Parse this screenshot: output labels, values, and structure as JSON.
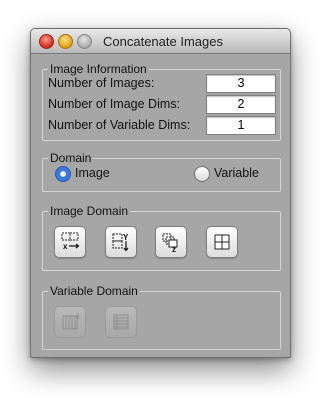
{
  "window": {
    "title": "Concatenate Images"
  },
  "image_information": {
    "legend": "Image Information",
    "rows": [
      {
        "label": "Number of Images:",
        "value": "3"
      },
      {
        "label": "Number of Image Dims:",
        "value": "2"
      },
      {
        "label": "Number of Variable Dims:",
        "value": "1"
      }
    ]
  },
  "domain": {
    "legend": "Domain",
    "options": [
      {
        "label": "Image",
        "selected": true
      },
      {
        "label": "Variable",
        "selected": false
      }
    ]
  },
  "image_domain": {
    "legend": "Image Domain",
    "buttons": [
      {
        "icon": "concat-x-icon"
      },
      {
        "icon": "concat-y-icon"
      },
      {
        "icon": "concat-z-icon"
      },
      {
        "icon": "concat-tile-icon"
      }
    ]
  },
  "variable_domain": {
    "legend": "Variable Domain",
    "buttons": [
      {
        "icon": "concat-variable-columns-icon",
        "enabled": false
      },
      {
        "icon": "concat-variable-rows-icon",
        "enabled": false
      }
    ]
  },
  "colors": {
    "panel": "#a6a6a6",
    "radio_selected": "#3a79d8"
  }
}
